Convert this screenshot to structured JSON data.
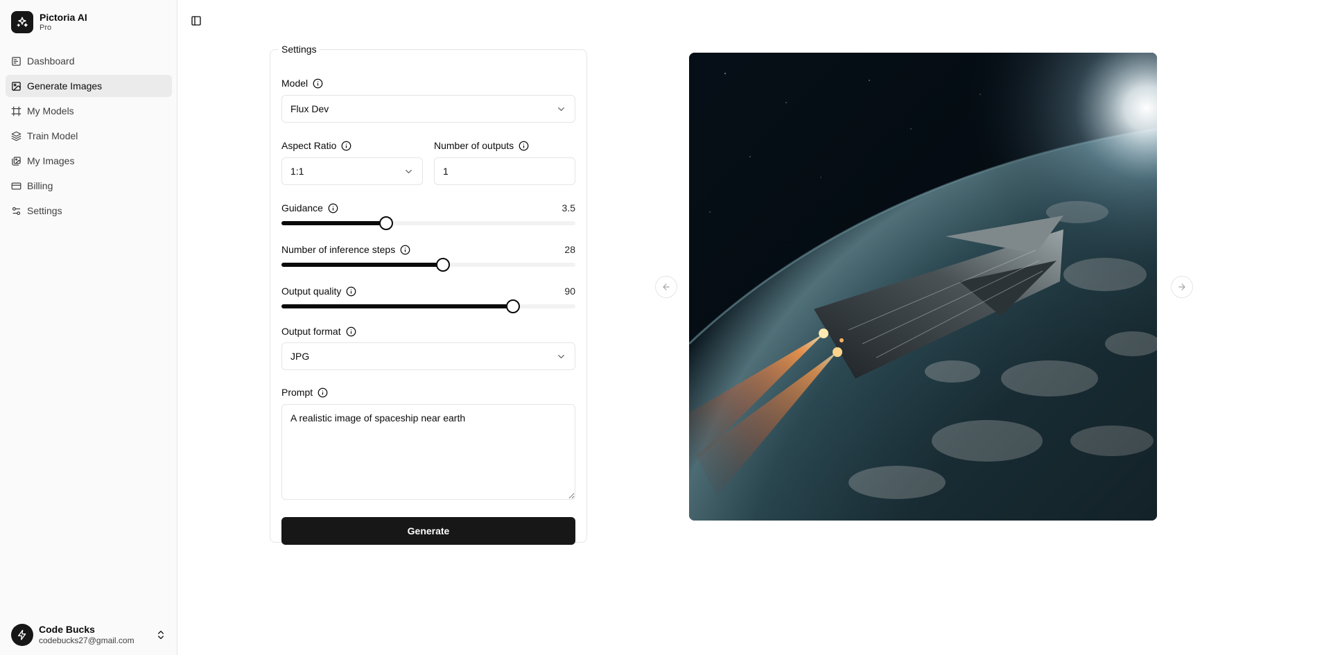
{
  "brand": {
    "name": "Pictoria AI",
    "plan": "Pro"
  },
  "nav": [
    {
      "label": "Dashboard",
      "icon": "dashboard-icon",
      "active": false
    },
    {
      "label": "Generate Images",
      "icon": "image-icon",
      "active": true
    },
    {
      "label": "My Models",
      "icon": "frame-icon",
      "active": false
    },
    {
      "label": "Train Model",
      "icon": "layers-icon",
      "active": false
    },
    {
      "label": "My Images",
      "icon": "images-icon",
      "active": false
    },
    {
      "label": "Billing",
      "icon": "credit-card-icon",
      "active": false
    },
    {
      "label": "Settings",
      "icon": "sliders-icon",
      "active": false
    }
  ],
  "user": {
    "name": "Code Bucks",
    "email": "codebucks27@gmail.com"
  },
  "settings": {
    "legend": "Settings",
    "model": {
      "label": "Model",
      "value": "Flux Dev"
    },
    "aspect_ratio": {
      "label": "Aspect Ratio",
      "value": "1:1"
    },
    "num_outputs": {
      "label": "Number of outputs",
      "value": "1"
    },
    "guidance": {
      "label": "Guidance",
      "value": "3.5",
      "fraction": 0.357
    },
    "inference_steps": {
      "label": "Number of inference steps",
      "value": "28",
      "fraction": 0.55
    },
    "output_quality": {
      "label": "Output quality",
      "value": "90",
      "fraction": 0.787
    },
    "output_format": {
      "label": "Output format",
      "value": "JPG"
    },
    "prompt": {
      "label": "Prompt",
      "value": "A realistic image of spaceship near earth"
    },
    "generate_label": "Generate"
  },
  "colors": {
    "primary": "#171717",
    "sidebar_bg": "#fafafa",
    "border": "#e5e5e5",
    "active_nav": "#ebebeb"
  }
}
